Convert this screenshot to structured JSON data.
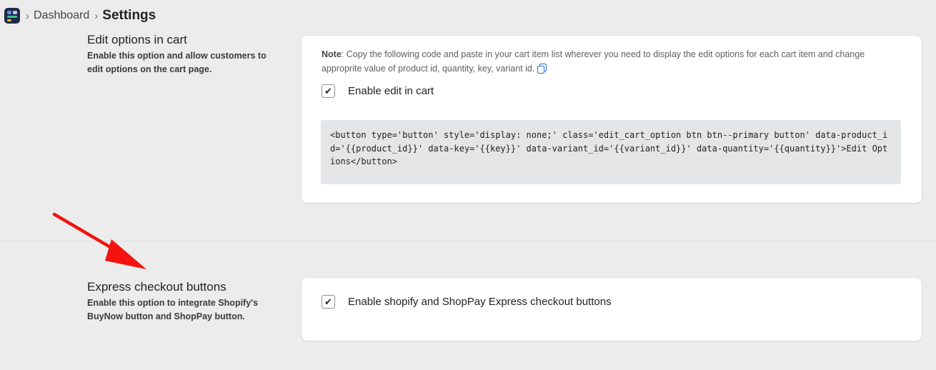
{
  "breadcrumb": {
    "app_icon": "app-logo-icon",
    "items": [
      "Dashboard"
    ],
    "current": "Settings",
    "separator": "›"
  },
  "sections": {
    "edit_cart": {
      "title": "Edit options in cart",
      "description": "Enable this option and allow customers to edit options on the cart page.",
      "note_label": "Note",
      "note_text": ": Copy the following code and paste in your cart item list wherever you need to display the edit options for each cart item and change approprite value of product id, quantity, key, variant id.",
      "copy_icon": "copy-icon",
      "checkbox_label": "Enable edit in cart",
      "checked": true,
      "code": "<button type='button' style='display: none;' class='edit_cart_option btn btn--primary button' data-product_id='{{product_id}}' data-key='{{key}}' data-variant_id='{{variant_id}}' data-quantity='{{quantity}}'>Edit Options</button>"
    },
    "express_checkout": {
      "title": "Express checkout buttons",
      "description": "Enable this option to integrate Shopify's BuyNow button and ShopPay button.",
      "checkbox_label": "Enable shopify and ShopPay Express checkout buttons",
      "checked": true
    }
  },
  "annotation": {
    "arrow_icon": "red-arrow-icon",
    "color": "#f3130f"
  },
  "colors": {
    "background": "#ececec",
    "card": "#ffffff",
    "code_background": "#e4e5e7",
    "link_blue": "#2c6ecb"
  }
}
